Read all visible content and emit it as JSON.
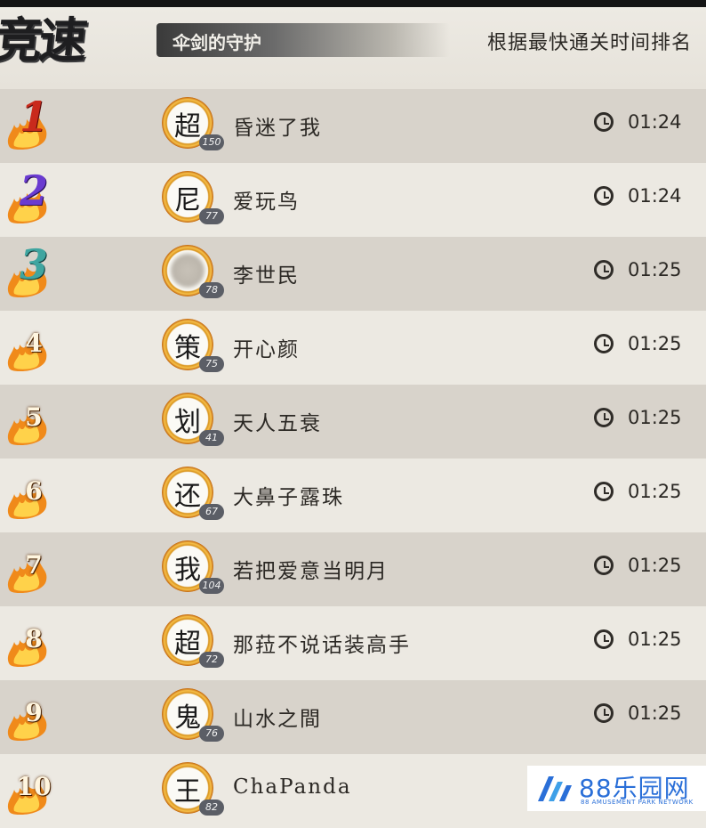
{
  "header": {
    "title_fragment": "竞速",
    "dungeon_name": "伞剑的守护",
    "sort_note": "根据最快通关时间排名"
  },
  "rows": [
    {
      "rank": "1",
      "avatar_char": "超",
      "level": "150",
      "name": "昏迷了我",
      "time": "01:24",
      "avatar_blurred": false
    },
    {
      "rank": "2",
      "avatar_char": "尼",
      "level": "77",
      "name": "爱玩鸟",
      "time": "01:24",
      "avatar_blurred": false
    },
    {
      "rank": "3",
      "avatar_char": "",
      "level": "78",
      "name": "李世民",
      "time": "01:25",
      "avatar_blurred": true
    },
    {
      "rank": "4",
      "avatar_char": "策",
      "level": "75",
      "name": "开心颜",
      "time": "01:25",
      "avatar_blurred": false
    },
    {
      "rank": "5",
      "avatar_char": "划",
      "level": "41",
      "name": "天人五衰",
      "time": "01:25",
      "avatar_blurred": false
    },
    {
      "rank": "6",
      "avatar_char": "还",
      "level": "67",
      "name": "大鼻子露珠",
      "time": "01:25",
      "avatar_blurred": false
    },
    {
      "rank": "7",
      "avatar_char": "我",
      "level": "104",
      "name": "若把爱意当明月",
      "time": "01:25",
      "avatar_blurred": false
    },
    {
      "rank": "8",
      "avatar_char": "超",
      "level": "72",
      "name": "那菈不说话装高手",
      "time": "01:25",
      "avatar_blurred": false
    },
    {
      "rank": "9",
      "avatar_char": "鬼",
      "level": "76",
      "name": "山水之間",
      "time": "01:25",
      "avatar_blurred": false
    },
    {
      "rank": "10",
      "avatar_char": "王",
      "level": "82",
      "name": "ChaPanda",
      "time": "",
      "avatar_blurred": false
    }
  ],
  "watermark": {
    "brand": "88乐园网",
    "tagline": "88 AMUSEMENT PARK NETWORK"
  },
  "colors": {
    "row_shade": "#d8d3cb",
    "row_light": "#ece9e2",
    "flame": "#f08a1a",
    "rank1": "#c92a1c",
    "rank2": "#6a3bd0",
    "rank3": "#3fa5a0",
    "watermark_blue": "#2a6fd8"
  },
  "icons": {
    "rank_marker": "flame-icon",
    "time": "clock-icon",
    "watermark": "88-logo-icon"
  }
}
